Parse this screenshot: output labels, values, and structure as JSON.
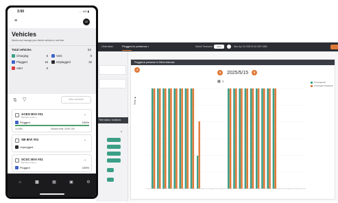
{
  "phone": {
    "status_time": "3:50",
    "status_icons": "…∙ 5G ▮",
    "menu_icon": "hamburger-menu-icon",
    "avatar_initials": "CE",
    "title": "Vehicles",
    "subtitle": "Monitor and manage your electric vehicles in real time",
    "total_label": "Total vehicles",
    "total_value": "52",
    "stats": [
      {
        "label": "Charging",
        "value": "5",
        "color": "#3c9f86"
      },
      {
        "label": "V2G",
        "value": "0",
        "color": "#3f62c8"
      },
      {
        "label": "Plugged",
        "value": "15",
        "color": "#3f62c8"
      },
      {
        "label": "Unplugged",
        "value": "32",
        "color": "#2a2a2e"
      },
      {
        "label": "Alert",
        "value": "0",
        "color": "#d83c3c"
      }
    ],
    "schedule_button": "New schedule",
    "vehicles": [
      {
        "name": "ACES IEVI #01",
        "sub": "Blue Bird Jouley 1",
        "status": "Plugged",
        "status_color": "#3f62c8",
        "pct": "100%",
        "kwh": "14 kWh",
        "session": "Session time: 3d 5h 12m"
      },
      {
        "name": "SB IEVI #01",
        "status": "Unplugged",
        "status_color": "#2a2a2e"
      },
      {
        "name": "SCSC IEVI #01",
        "sub": "Blue Bird Jouley 1",
        "status": "Plugged",
        "status_color": "#3f62c8",
        "pct": "100%"
      }
    ],
    "nav_icons": [
      "home-icon",
      "bus-icon",
      "schedule-icon",
      "charger-icon",
      "settings-icon"
    ]
  },
  "desktop": {
    "tabs": [
      "Overview",
      "Plugged-in presence •"
    ],
    "time_label": "Select Timezone",
    "timezone": "Auto",
    "date_range": "Mon Apr 15 2025 00:15 GMT-0500",
    "panel_title": "Plugged-in presence in 15min intervals",
    "left_panel_title": "Fleet status / durations",
    "pill_labels": [
      "",
      "",
      "",
      "",
      "",
      ""
    ],
    "left_count": "4",
    "chart_title": "2025/5/15",
    "vehicle_count": "3",
    "markers": [
      "4",
      "3",
      "5"
    ],
    "legend": [
      "Unmanaged ■",
      "Unmanaged charging ■"
    ],
    "y_label": "Time ▲"
  },
  "chart_data": {
    "type": "bar",
    "title": "2025/5/15",
    "ylabel": "Time",
    "series": [
      {
        "name": "Unmanaged",
        "color": "#3c9f86"
      },
      {
        "name": "Unmanaged charging",
        "color": "#e07a3a"
      }
    ],
    "colors": {
      "teal": "#3c9f86",
      "orange": "#e07a3a"
    }
  }
}
